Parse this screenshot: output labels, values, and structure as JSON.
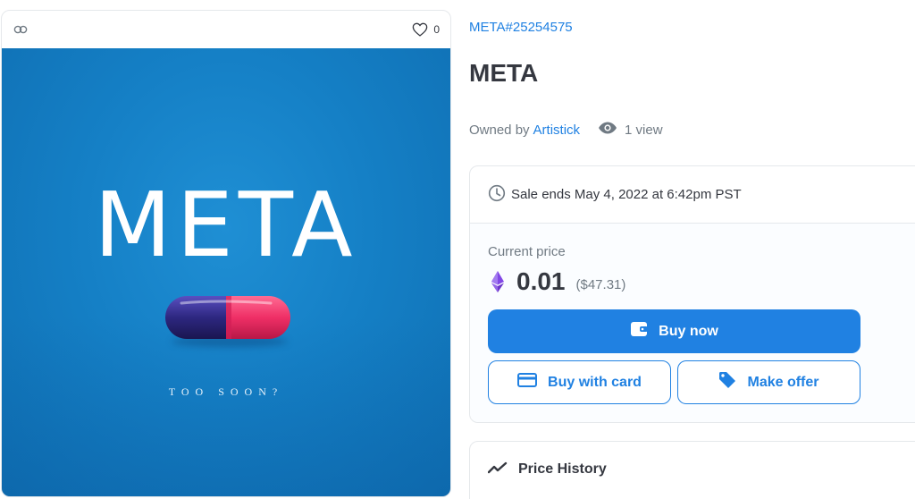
{
  "asset": {
    "favorite_count": "0",
    "artwork": {
      "title": "META",
      "subtitle": "TOO SOON?"
    }
  },
  "item": {
    "collection_link": "META#25254575",
    "title": "META",
    "owned_by_label": "Owned by",
    "owner": "Artistick",
    "views": "1 view"
  },
  "trade": {
    "sale_ends": "Sale ends May 4, 2022 at 6:42pm PST",
    "current_price_label": "Current price",
    "price": "0.01",
    "price_usd": "($47.31)",
    "buy_now_label": "Buy now",
    "buy_with_card_label": "Buy with card",
    "make_offer_label": "Make offer"
  },
  "price_history": {
    "title": "Price History"
  },
  "icons": {
    "chain": "chain-link-icon",
    "favorite": "heart-icon",
    "views": "eye-icon",
    "clock": "clock-icon",
    "currency": "ethereum-icon",
    "wallet": "wallet-icon",
    "card": "credit-card-icon",
    "tag": "tag-icon",
    "trend": "trending-line-icon"
  },
  "colors": {
    "accent": "#2081e2",
    "text": "#353840",
    "muted": "#707a83",
    "border": "#e5e8eb",
    "artwork_bg": "#1580c6",
    "pill_left": "#3b2f8f",
    "pill_right": "#f0346c",
    "eth": "#8247e5"
  }
}
